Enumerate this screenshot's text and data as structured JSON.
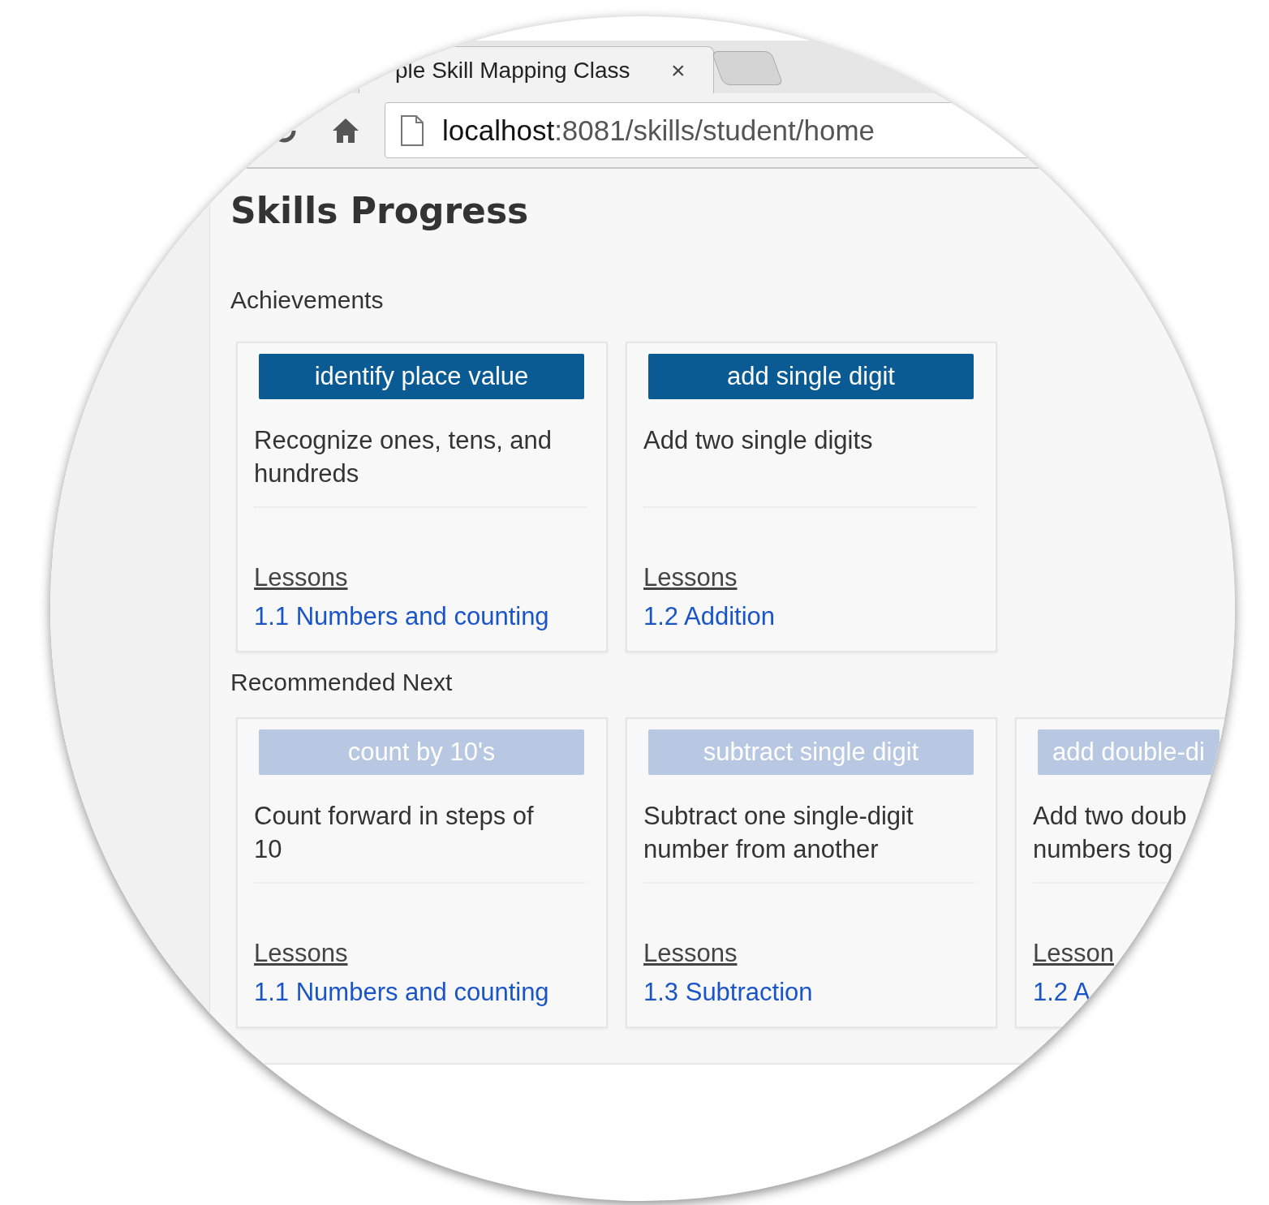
{
  "browser": {
    "tab_title": "ple Skill Mapping Class",
    "tab_close": "×",
    "url_host": "localhost",
    "url_path": ":8081/skills/student/home"
  },
  "page": {
    "title": "Skills Progress",
    "sections": [
      {
        "heading": "Achievements",
        "skills": [
          {
            "name": "identify place value",
            "achieved": true,
            "description_lines": [
              "Recognize ones, tens, and",
              "hundreds"
            ],
            "lessons_label": "Lessons",
            "lesson": "1.1 Numbers and counting"
          },
          {
            "name": "add single digit",
            "achieved": true,
            "description_lines": [
              "Add two single digits"
            ],
            "lessons_label": "Lessons",
            "lesson": "1.2 Addition"
          }
        ]
      },
      {
        "heading": "Recommended Next",
        "skills": [
          {
            "name": "count by 10's",
            "achieved": false,
            "description_lines": [
              "Count forward in steps of",
              "10"
            ],
            "lessons_label": "Lessons",
            "lesson": "1.1 Numbers and counting"
          },
          {
            "name": "subtract single digit",
            "achieved": false,
            "description_lines": [
              "Subtract one single-digit",
              "number from another"
            ],
            "lessons_label": "Lessons",
            "lesson": "1.3 Subtraction"
          },
          {
            "name": "add double-di",
            "achieved": false,
            "description_lines": [
              "Add two doub",
              "numbers tog"
            ],
            "lessons_label": "Lesson",
            "lesson": "1.2 A"
          }
        ]
      }
    ]
  }
}
